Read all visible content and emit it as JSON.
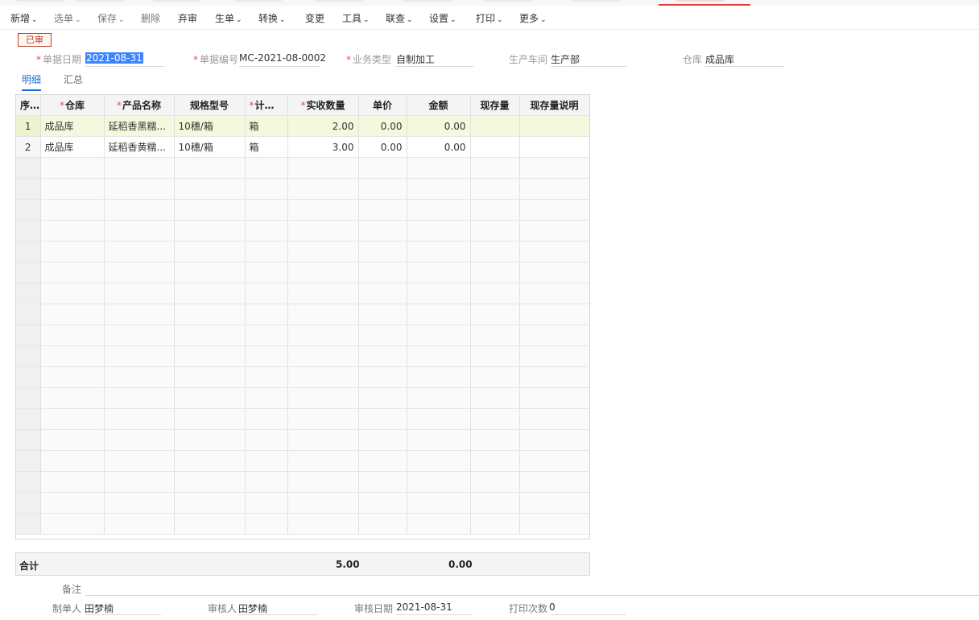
{
  "status_badge": "已审",
  "toolbar": [
    {
      "label": "新增",
      "dropdown": true
    },
    {
      "label": "选单",
      "dropdown": true,
      "dim": true
    },
    {
      "label": "保存",
      "dropdown": true,
      "dim": true
    },
    {
      "label": "删除",
      "dropdown": false,
      "dim": true
    },
    {
      "label": "弃审",
      "dropdown": false
    },
    {
      "label": "生单",
      "dropdown": true
    },
    {
      "label": "转换",
      "dropdown": true
    },
    {
      "label": "变更",
      "dropdown": false
    },
    {
      "label": "工具",
      "dropdown": true
    },
    {
      "label": "联查",
      "dropdown": true
    },
    {
      "label": "设置",
      "dropdown": true
    },
    {
      "label": "打印",
      "dropdown": true
    },
    {
      "label": "更多",
      "dropdown": true
    }
  ],
  "header": {
    "doc_date_label": "单据日期",
    "doc_date": "2021-08-31",
    "doc_no_label": "单据编号",
    "doc_no": "MC-2021-08-0002",
    "biz_type_label": "业务类型",
    "biz_type": "自制加工",
    "workshop_label": "生产车间",
    "workshop": "生产部",
    "warehouse_label": "仓库",
    "warehouse": "成品库"
  },
  "subtabs": [
    "明细",
    "汇总"
  ],
  "grid": {
    "columns": [
      {
        "label": "序号",
        "required": false
      },
      {
        "label": "仓库",
        "required": true
      },
      {
        "label": "产品名称",
        "required": true
      },
      {
        "label": "规格型号",
        "required": false
      },
      {
        "label": "计量单位",
        "required": true
      },
      {
        "label": "实收数量",
        "required": true
      },
      {
        "label": "单价",
        "required": false
      },
      {
        "label": "金额",
        "required": false
      },
      {
        "label": "现存量",
        "required": false
      },
      {
        "label": "现存量说明",
        "required": false
      }
    ],
    "rows": [
      {
        "idx": "1",
        "warehouse": "成品库",
        "product": "延稻香黑糯...",
        "spec": "10穗/箱",
        "unit": "箱",
        "qty": "2.00",
        "price": "0.00",
        "amount": "0.00",
        "stock": "",
        "stock_note": ""
      },
      {
        "idx": "2",
        "warehouse": "成品库",
        "product": "延稻香黄糯...",
        "spec": "10穗/箱",
        "unit": "箱",
        "qty": "3.00",
        "price": "0.00",
        "amount": "0.00",
        "stock": "",
        "stock_note": ""
      }
    ]
  },
  "totals": {
    "label": "合计",
    "qty": "5.00",
    "amount": "0.00"
  },
  "footer": {
    "remark_label": "备注",
    "remark": "",
    "maker_label": "制单人",
    "maker": "田梦楠",
    "auditor_label": "审核人",
    "auditor": "田梦楠",
    "audit_date_label": "审核日期",
    "audit_date": "2021-08-31",
    "print_count_label": "打印次数",
    "print_count": "0"
  },
  "colors": {
    "accent": "#1e6fd9",
    "required": "#d9534f",
    "status": "#c0392b",
    "row_highlight": "#f4f8dc"
  }
}
